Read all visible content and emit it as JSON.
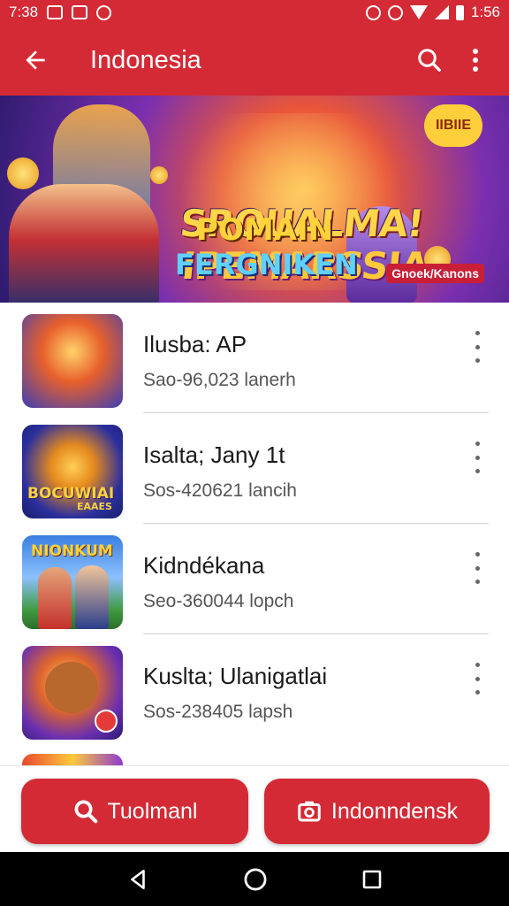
{
  "status_bar": {
    "time": "7:38",
    "clock_right": "1:56"
  },
  "app_bar": {
    "title": "Indonesia",
    "back_icon": "arrow-left-icon",
    "search_icon": "search-icon",
    "more_icon": "more-vertical-icon"
  },
  "banner": {
    "title_line1": "SROUALMA!",
    "title_line2": "IPEMARSSIA",
    "title_line3": "POMAIN",
    "title_line4": "FERGNIKEN",
    "badge": "IIBIIE",
    "tag": "Gnoek/Kanons"
  },
  "list": {
    "items": [
      {
        "title": "Ilusba: AP",
        "subtitle": "Sao-96,023 lanerh"
      },
      {
        "title": "Isalta; Jany 1t",
        "subtitle": "Sos-420621 lancih"
      },
      {
        "title": "Kidndékana",
        "subtitle": "Seo-360044 lopch"
      },
      {
        "title": "Kuslta; Ulanigatlai",
        "subtitle": "Sos-238405 lapsh"
      }
    ],
    "thumb2_text": "BOCUWIAI",
    "thumb2_subtext": "EAAES",
    "thumb3_text": "NIONKUM"
  },
  "actions": {
    "left_label": "Tuolmanl",
    "right_label": "Indonndensk",
    "left_icon": "search-icon",
    "right_icon": "camera-icon"
  },
  "colors": {
    "primary": "#d42a35",
    "navbar": "#000000"
  }
}
